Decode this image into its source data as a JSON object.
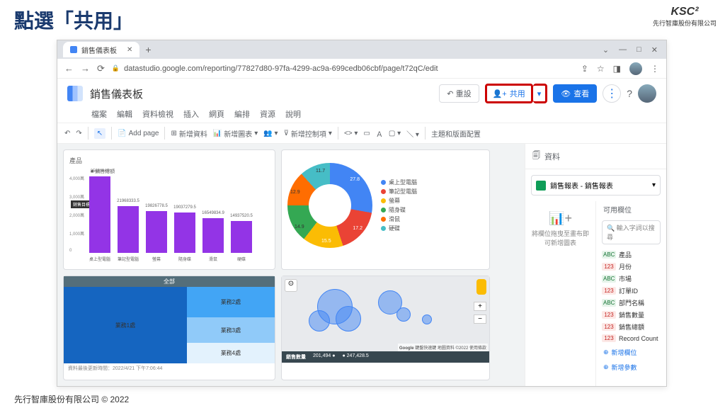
{
  "slide": {
    "title": "點選「共用」",
    "footer": "先行智庫股份有限公司 © 2022",
    "logo": "KSC²",
    "logo_sub": "先行智庫股份有限公司"
  },
  "browser": {
    "tab": "銷售儀表板",
    "url": "datastudio.google.com/reporting/77827d80-97fa-4299-ac9a-699cedb06cbf/page/t72qC/edit",
    "win": {
      "min": "—",
      "max": "□",
      "close": "✕"
    },
    "nav": {
      "back": "←",
      "fwd": "→",
      "reload": "⟳"
    },
    "actions": {
      "share": "⇪",
      "star": "☆",
      "ext": "◨"
    }
  },
  "app": {
    "title": "銷售儀表板",
    "menu": [
      "檔案",
      "編輯",
      "資料檢視",
      "插入",
      "網頁",
      "編排",
      "資源",
      "說明"
    ],
    "btn": {
      "reset": "↶ 重設",
      "share": "共用",
      "view": "查看"
    }
  },
  "toolbar": {
    "undo": "↶",
    "redo": "↷",
    "add_page": "Add page",
    "add_data": "新增資料",
    "add_chart": "新增圖表",
    "add_control": "新增控制項",
    "theme": "主題和版面配置"
  },
  "panel": {
    "hdr": "資料",
    "src": "銷售報表 - 銷售報表",
    "drop": "將欄位拖曳至畫布即可新增圖表",
    "fields_hdr": "可用欄位",
    "search": "輸入字詞以搜尋",
    "fields": [
      {
        "t": "abc",
        "n": "產品"
      },
      {
        "t": "123",
        "n": "月份"
      },
      {
        "t": "abc",
        "n": "市場"
      },
      {
        "t": "123",
        "n": "訂單ID"
      },
      {
        "t": "abc",
        "n": "部門名稱"
      },
      {
        "t": "123",
        "n": "銷售數量"
      },
      {
        "t": "123",
        "n": "銷售總額"
      },
      {
        "t": "123",
        "n": "Record Count"
      }
    ],
    "add_field": "新增欄位",
    "add_param": "新增參數"
  },
  "chart_data": [
    {
      "type": "bar",
      "title": "產品",
      "legend": "銷售總額",
      "goal_label": "銷售目標",
      "categories": [
        "桌上型電腦",
        "筆記型電腦",
        "螢幕",
        "隨身碟",
        "滑鼠",
        "硬碟"
      ],
      "values": [
        35691840,
        21968333.5,
        19826778.5,
        19037279.5,
        16549834.9,
        14937520.5
      ],
      "ylim": [
        0,
        40000000
      ],
      "yticks": [
        "4,000萬",
        "3,000萬",
        "2,000萬",
        "1,000萬",
        "0"
      ]
    },
    {
      "type": "pie",
      "slices": [
        {
          "label": "桌上型電腦",
          "pct": 27.8,
          "color": "#4285f4"
        },
        {
          "label": "筆記型電腦",
          "pct": 17.2,
          "color": "#ea4335"
        },
        {
          "label": "螢幕",
          "pct": 15.5,
          "color": "#fbbc04"
        },
        {
          "label": "隨身碟",
          "pct": 14.9,
          "color": "#34a853"
        },
        {
          "label": "滑鼠",
          "pct": 12.9,
          "color": "#ff6d01"
        },
        {
          "label": "硬碟",
          "pct": 11.7,
          "color": "#46bdc6"
        }
      ]
    },
    {
      "type": "treemap",
      "title": "全部",
      "items": [
        {
          "label": "業務1處"
        },
        {
          "label": "業務2處"
        },
        {
          "label": "業務3處"
        },
        {
          "label": "業務4處"
        }
      ]
    },
    {
      "type": "map",
      "footer_logo": "Google",
      "footer": "鍵盤快速鍵  地圖資料 ©2022  使用條款",
      "stats_label": "銷售數量",
      "stats": [
        "201,494 ●",
        "● 247,428.5"
      ]
    }
  ],
  "timestamp": "資料最後更新時間：2022/4/21 下午7:06:44"
}
